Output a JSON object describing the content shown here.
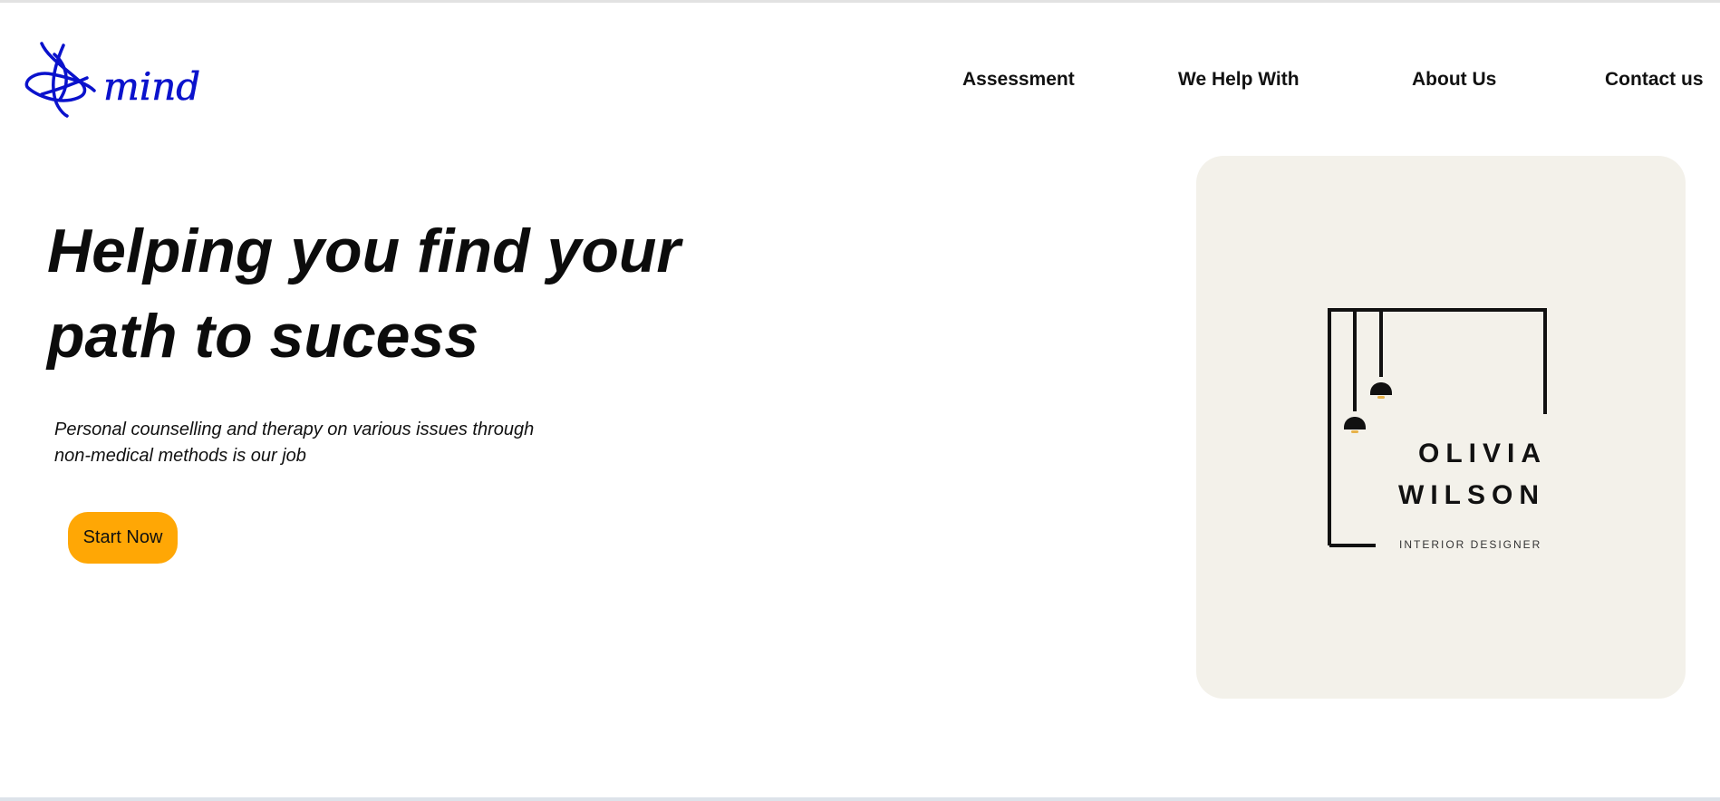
{
  "brand": {
    "logo_text": "mind",
    "logo_color": "#0a12cc"
  },
  "nav": {
    "items": [
      {
        "label": "Assessment"
      },
      {
        "label": "We Help With"
      },
      {
        "label": "About Us"
      },
      {
        "label": "Contact us"
      }
    ]
  },
  "hero": {
    "title_line1": "Helping you find your",
    "title_line2": "path to sucess",
    "subtitle_line1": "Personal counselling and therapy on various issues through",
    "subtitle_line2": "non-medical methods is our job",
    "cta_label": "Start Now",
    "cta_color": "#ffa705"
  },
  "card": {
    "background": "#f3f1ea",
    "first_name": "OLIVIA",
    "last_name": "WILSON",
    "role": "INTERIOR DESIGNER"
  }
}
